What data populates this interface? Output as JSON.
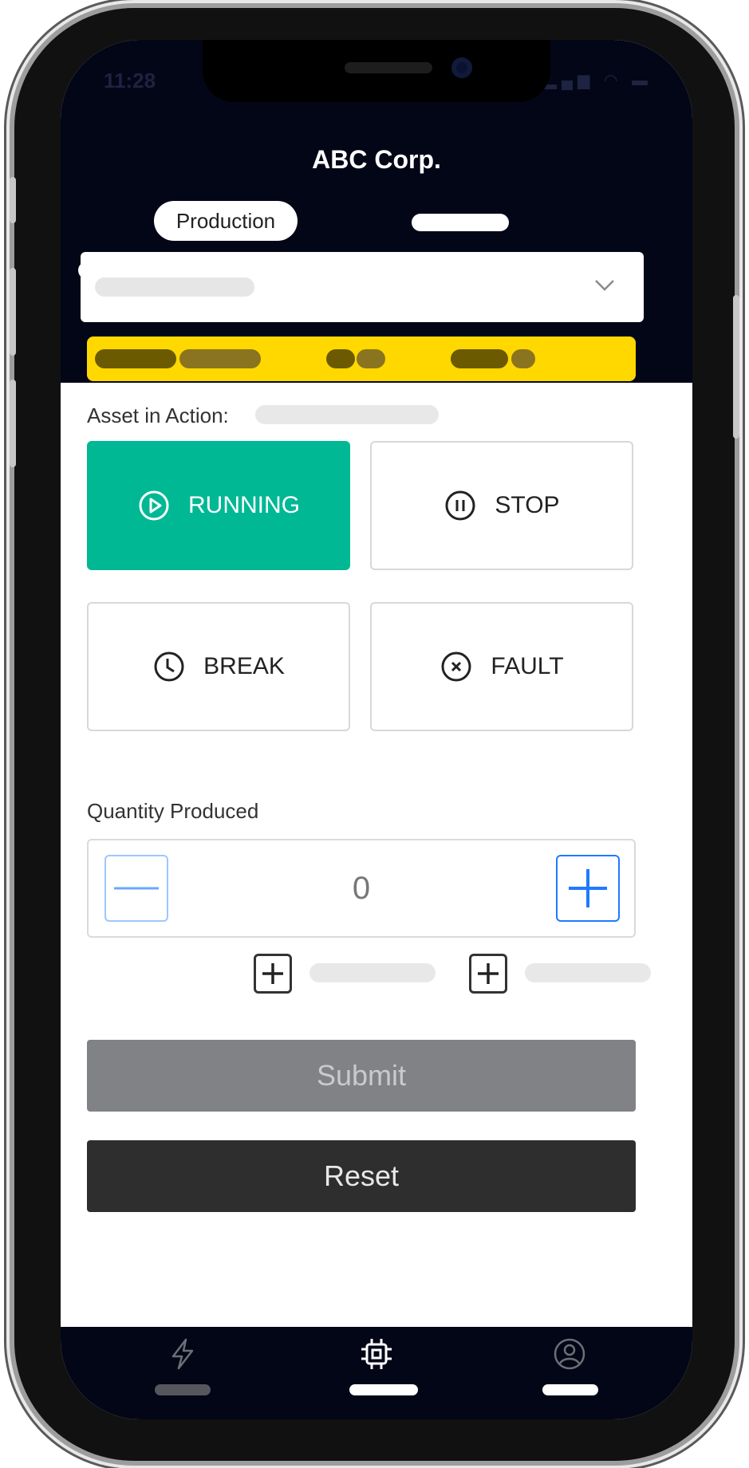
{
  "app": {
    "title": "ABC Corp."
  },
  "status_bar": {
    "time": "11:28",
    "signal": "▂▄▆"
  },
  "header": {
    "active_tab": "Production"
  },
  "asset": {
    "label": "Asset in Action:"
  },
  "states": [
    {
      "label": "RUNNING",
      "icon": "play-circle-icon",
      "active": true
    },
    {
      "label": "STOP",
      "icon": "pause-circle-icon",
      "active": false
    },
    {
      "label": "BREAK",
      "icon": "clock-icon",
      "active": false
    },
    {
      "label": "FAULT",
      "icon": "x-circle-icon",
      "active": false
    }
  ],
  "quantity": {
    "label": "Quantity Produced",
    "value": "0"
  },
  "actions": {
    "submit_label": "Submit",
    "reset_label": "Reset"
  },
  "bottom_nav": [
    {
      "icon": "lightning-icon",
      "active": false
    },
    {
      "icon": "chip-icon",
      "active": true
    },
    {
      "icon": "user-circle-icon",
      "active": false
    }
  ],
  "colors": {
    "header_bg": "#030617",
    "banner": "#ffd800",
    "running": "#00b894",
    "accent_blue": "#1f7aff",
    "submit_disabled": "#808285",
    "reset": "#2e2e2e"
  }
}
